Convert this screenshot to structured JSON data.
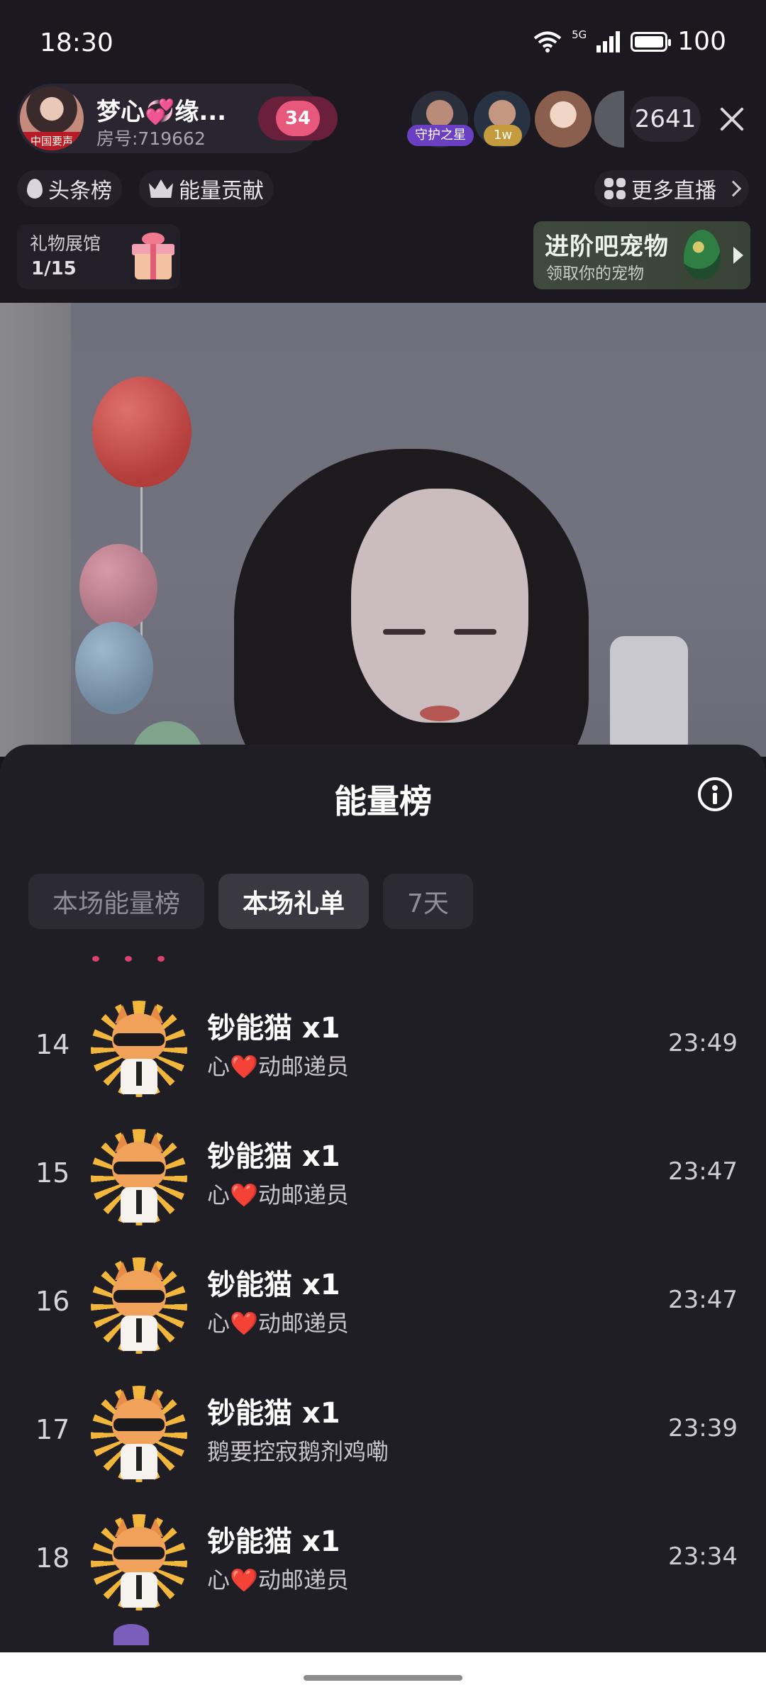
{
  "status_bar": {
    "time": "18:30",
    "network_label": "5G",
    "battery": "100",
    "icons": [
      "wifi-icon",
      "signal-icon",
      "battery-icon"
    ]
  },
  "host": {
    "name": "梦心💞缘...",
    "room": "房号:719662",
    "avatar_badge": "中国要声",
    "level": "34"
  },
  "viewers": {
    "tags": [
      "守护之星",
      "1w"
    ],
    "count": "2641"
  },
  "chips": {
    "headline": "头条榜",
    "energy": "能量贡献",
    "more_live": "更多直播"
  },
  "gift_hall": {
    "title": "礼物展馆",
    "count": "1/15"
  },
  "pet_banner": {
    "title": "进阶吧宠物",
    "subtitle": "领取你的宠物"
  },
  "sheet": {
    "title": "能量榜",
    "tabs": [
      "本场能量榜",
      "本场礼单",
      "7天"
    ],
    "active_tab": "本场礼单"
  },
  "gift_list": [
    {
      "rank": "14",
      "gift": "钞能猫  x1",
      "sender": "心❤️动邮递员",
      "time": "23:49"
    },
    {
      "rank": "15",
      "gift": "钞能猫  x1",
      "sender": "心❤️动邮递员",
      "time": "23:47"
    },
    {
      "rank": "16",
      "gift": "钞能猫  x1",
      "sender": "心❤️动邮递员",
      "time": "23:47"
    },
    {
      "rank": "17",
      "gift": "钞能猫  x1",
      "sender": "鹅要控寂鹅剂鸡嘞",
      "time": "23:39"
    },
    {
      "rank": "18",
      "gift": "钞能猫  x1",
      "sender": "心❤️动邮递员",
      "time": "23:34"
    }
  ],
  "colors": {
    "sheet_bg": "#1f1e24",
    "tab_active": "#3a3942",
    "level_badge": "#e8577c"
  }
}
